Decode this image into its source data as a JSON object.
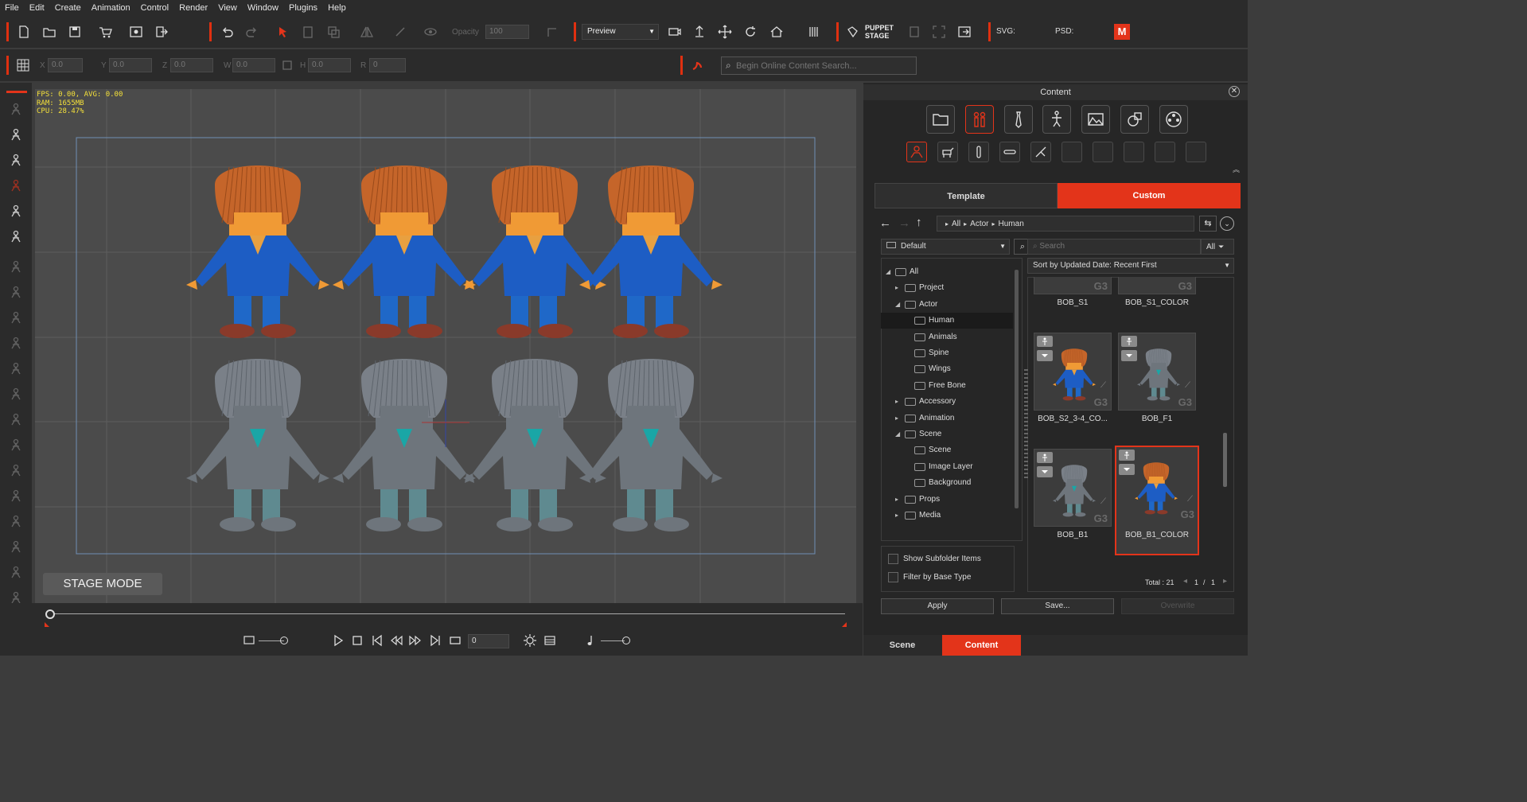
{
  "menu": [
    "File",
    "Edit",
    "Create",
    "Animation",
    "Control",
    "Render",
    "View",
    "Window",
    "Plugins",
    "Help"
  ],
  "toolbar": {
    "opacity_label": "Opacity",
    "opacity_value": "100",
    "preview_mode": "Preview",
    "puppet_stage_line1": "PUPPET",
    "puppet_stage_line2": "STAGE",
    "svg_label": "SVG:",
    "psd_label": "PSD:",
    "brand_letter": "M"
  },
  "transform": {
    "x_label": "X",
    "x_value": "0.0",
    "y_label": "Y",
    "y_value": "0.0",
    "z_label": "Z",
    "z_value": "0.0",
    "w_label": "W",
    "w_value": "0.0",
    "h_label": "H",
    "h_value": "0.0",
    "r_label": "R",
    "r_value": "0"
  },
  "search": {
    "placeholder": "Begin Online Content Search..."
  },
  "viewport": {
    "stats": "FPS: 0.00, AVG: 0.00\nRAM: 1655MB\nCPU: 28.47%",
    "stage_mode": "STAGE MODE"
  },
  "timeline": {
    "frame_value": "0"
  },
  "content": {
    "title": "Content",
    "tab_template": "Template",
    "tab_custom": "Custom",
    "breadcrumb": [
      "All",
      "Actor",
      "Human"
    ],
    "filter_preset": "Default",
    "search_placeholder": "Search",
    "search_scope": "All",
    "sort": "Sort by Updated Date: Recent First",
    "tree": [
      {
        "label": "All",
        "depth": 0,
        "toggle": "open"
      },
      {
        "label": "Project",
        "depth": 1,
        "toggle": "closed"
      },
      {
        "label": "Actor",
        "depth": 1,
        "toggle": "open"
      },
      {
        "label": "Human",
        "depth": 2,
        "toggle": "none",
        "selected": true
      },
      {
        "label": "Animals",
        "depth": 2,
        "toggle": "none"
      },
      {
        "label": "Spine",
        "depth": 2,
        "toggle": "none"
      },
      {
        "label": "Wings",
        "depth": 2,
        "toggle": "none"
      },
      {
        "label": "Free Bone",
        "depth": 2,
        "toggle": "none"
      },
      {
        "label": "Accessory",
        "depth": 1,
        "toggle": "closed"
      },
      {
        "label": "Animation",
        "depth": 1,
        "toggle": "closed"
      },
      {
        "label": "Scene",
        "depth": 1,
        "toggle": "open"
      },
      {
        "label": "Scene",
        "depth": 2,
        "toggle": "none"
      },
      {
        "label": "Image Layer",
        "depth": 2,
        "toggle": "none"
      },
      {
        "label": "Background",
        "depth": 2,
        "toggle": "none"
      },
      {
        "label": "Props",
        "depth": 1,
        "toggle": "closed"
      },
      {
        "label": "Media",
        "depth": 1,
        "toggle": "closed"
      }
    ],
    "items": [
      {
        "name": "BOB_S1",
        "color": false,
        "partial": true
      },
      {
        "name": "BOB_S1_COLOR",
        "color": false,
        "partial": true
      },
      {
        "name": "BOB_S2_3-4_CO...",
        "color": true
      },
      {
        "name": "BOB_F1",
        "color": false
      },
      {
        "name": "BOB_B1",
        "color": false
      },
      {
        "name": "BOB_B1_COLOR",
        "color": true,
        "selected": true
      }
    ],
    "g3_label": "G3",
    "show_subfolder": "Show Subfolder Items",
    "filter_base": "Filter by Base Type",
    "total_label": "Total : 21",
    "page_current": "1",
    "page_sep": "/",
    "page_total": "1",
    "apply": "Apply",
    "save": "Save...",
    "overwrite": "Overwrite",
    "bottom_scene": "Scene",
    "bottom_content": "Content"
  },
  "colors": {
    "accent": "#e3341a",
    "panel": "#2b2b2b",
    "viewport": "#4b4b4b",
    "hair": "#c5652a",
    "face": "#f09a35",
    "suit": "#1d5dc4",
    "shoe": "#8a3a2a",
    "gray": "#6e7882",
    "teal": "#1aa6a6"
  }
}
